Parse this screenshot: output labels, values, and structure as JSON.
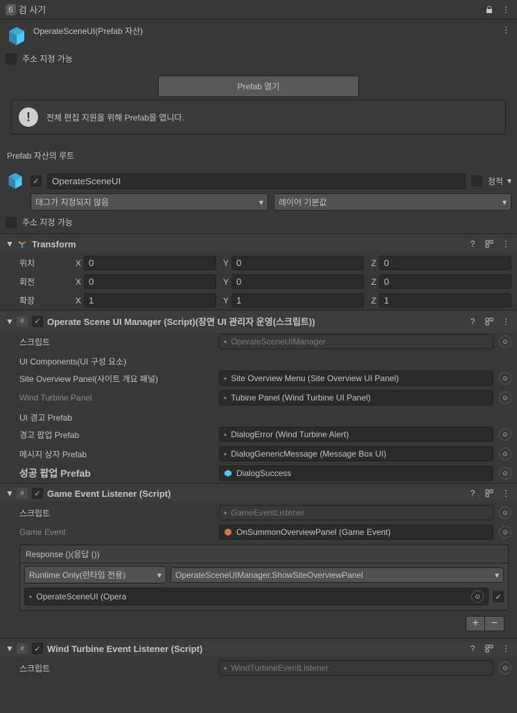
{
  "header": {
    "tab_badge": "6",
    "title": "검 사기"
  },
  "prefab": {
    "name": "OperateSceneUI(Prefab 자산)",
    "addressable_label": "주소 지정 가능",
    "open_button": "Prefab 열기",
    "info_message": "전체 편집 지원을 위해 Prefab을 엽니다.",
    "root_label": "Prefab 자산의 루트"
  },
  "root": {
    "name": "OperateSceneUI",
    "static_label": "정적",
    "tag_label": "태그가 지정되지 않음",
    "layer_label": "레이어 기본값",
    "addressable_label": "주소 지정 가능"
  },
  "transform": {
    "title": "Transform",
    "position_label": "위치",
    "rotation_label": "회전",
    "scale_label": "확장",
    "x": "X",
    "y": "Y",
    "z": "Z",
    "position": {
      "x": "0",
      "y": "0",
      "z": "0"
    },
    "rotation": {
      "x": "0",
      "y": "0",
      "z": "0"
    },
    "scale": {
      "x": "1",
      "y": "1",
      "z": "1"
    }
  },
  "operate_manager": {
    "title": "Operate Scene UI Manager (Script)(장면 UI 관리자 운영(스크립트))",
    "script_label": "스크립트",
    "script_value": "OperateSceneUIManager",
    "ui_components_heading": "UI Components(UI 구성 요소)",
    "site_overview_label": "Site Overview Panel(사이트 개요 패널)",
    "site_overview_value": "Site Overview Menu (Site Overview UI Panel)",
    "wind_turbine_label": "Wind Turbine Panel",
    "wind_turbine_value": "Tubine Panel (Wind Turbine UI Panel)",
    "ui_alert_heading": "UI 경고 Prefab",
    "alert_popup_label": "경고 팝업 Prefab",
    "alert_popup_value": "DialogError (Wind Turbine Alert)",
    "message_box_label": "메시지 상자 Prefab",
    "message_box_value": "DialogGenericMessage (Message Box UI)",
    "success_popup_label": "성공 팝업 Prefab",
    "success_popup_value": "DialogSuccess"
  },
  "game_event_listener": {
    "title": "Game Event Listener (Script)",
    "script_label": "스크립트",
    "script_value": "GameEventListener",
    "game_event_label": "Game Event",
    "game_event_value": "OnSummonOverviewPanel (Game Event)",
    "response_label": "Response ()(응답 ())",
    "runtime_label": "Runtime Only(런타임 전용)",
    "method_label": "OperateSceneUIManager.ShowSiteOverviewPanel",
    "target_value": "OperateSceneUI (Opera"
  },
  "wind_turbine_listener": {
    "title": "Wind Turbine Event Listener (Script)",
    "script_label": "스크립트",
    "script_value": "WindTurbineEventListener"
  }
}
